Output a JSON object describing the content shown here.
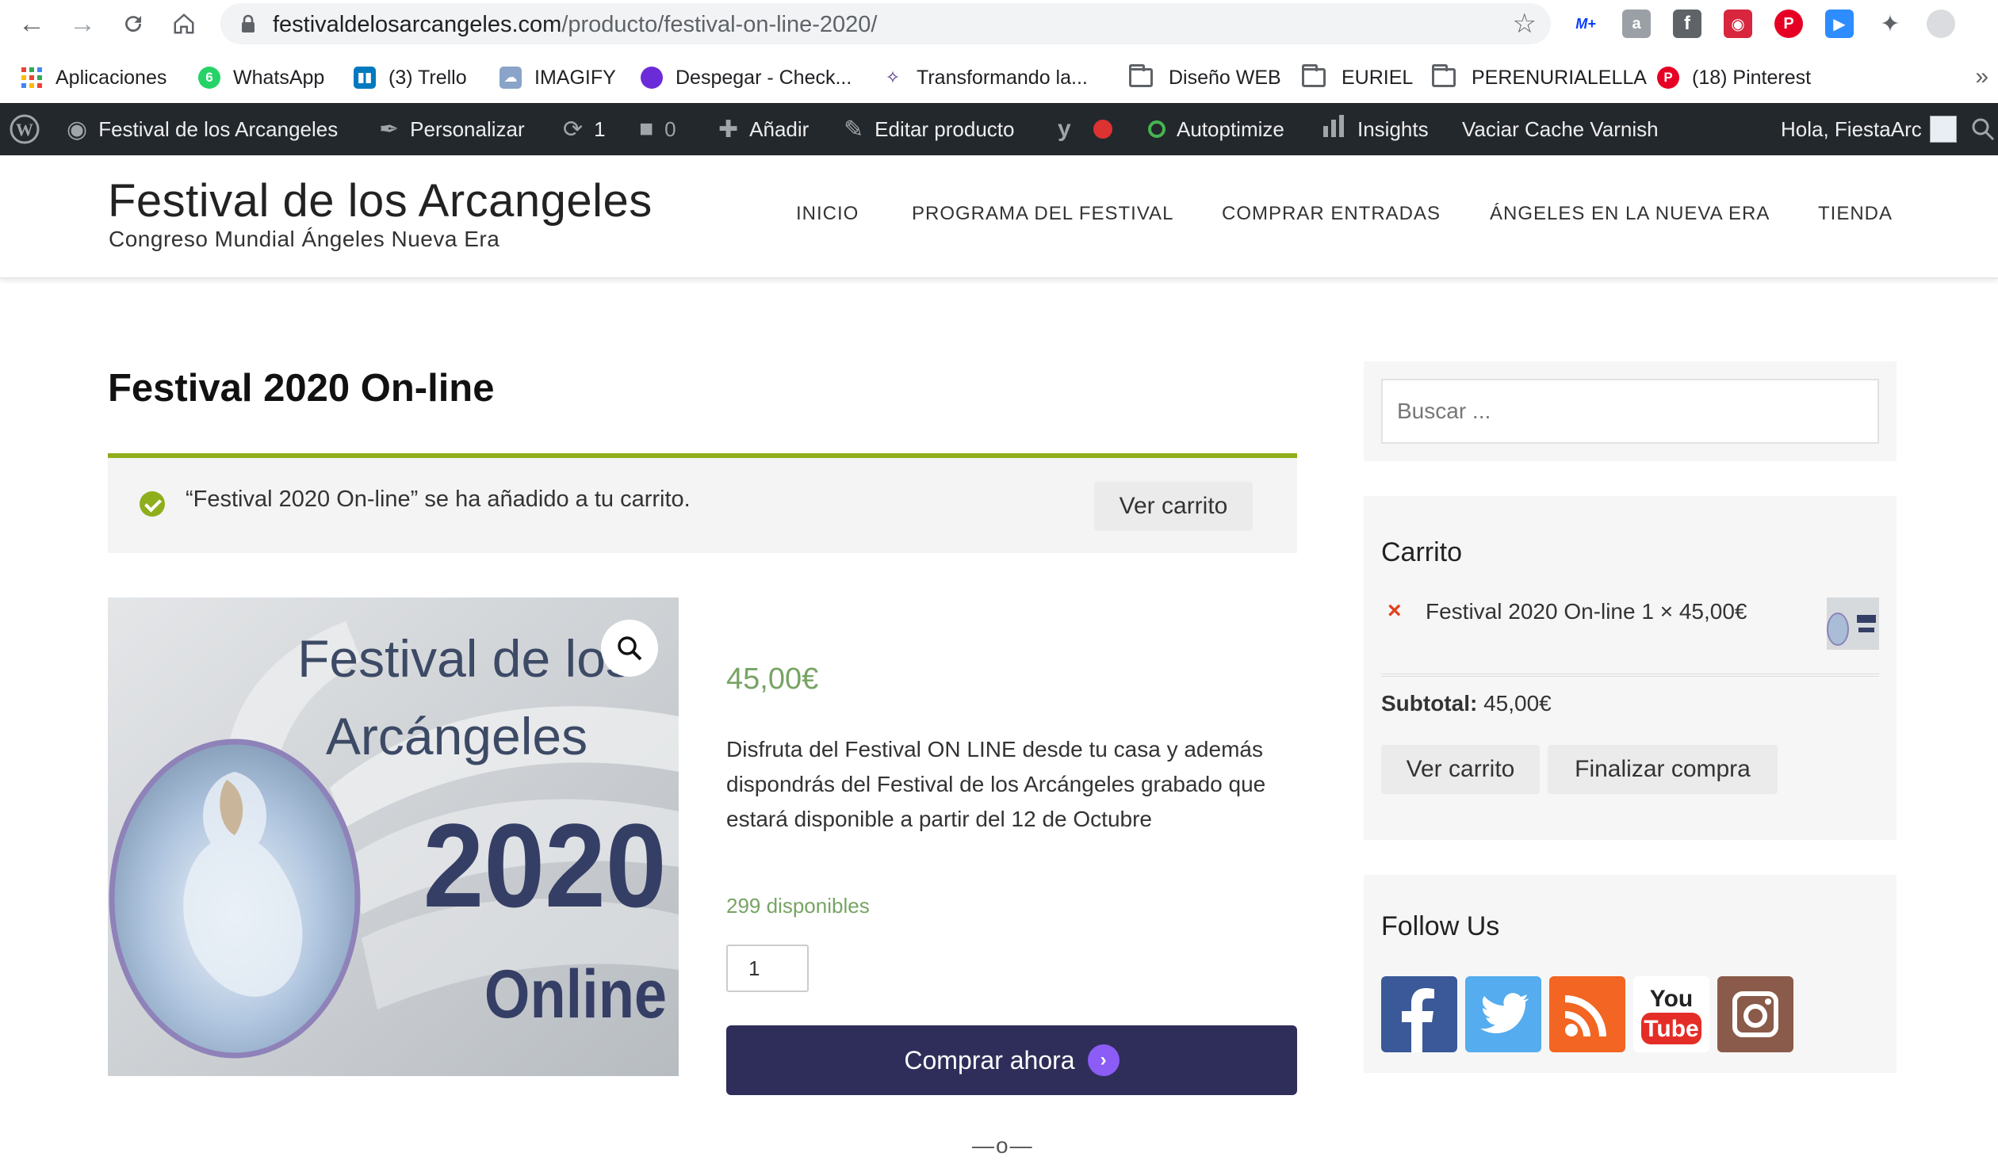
{
  "browser": {
    "url_domain": "festivaldelosarcangeles.com",
    "url_path": "/producto/festival-on-line-2020/"
  },
  "bookmarks": {
    "items": [
      {
        "label": "Aplicaciones"
      },
      {
        "label": "WhatsApp",
        "badge": "6"
      },
      {
        "label": "(3) Trello"
      },
      {
        "label": "IMAGIFY"
      },
      {
        "label": "Despegar - Check..."
      },
      {
        "label": "Transformando la..."
      },
      {
        "label": "Diseño WEB"
      },
      {
        "label": "EURIEL"
      },
      {
        "label": "PERENURIALELLA"
      },
      {
        "label": "(18) Pinterest"
      }
    ],
    "more": "»"
  },
  "adminbar": {
    "site": "Festival de los Arcangeles",
    "customize": "Personalizar",
    "updates_count": "1",
    "comments_count": "0",
    "add_new": "Añadir",
    "edit_product": "Editar producto",
    "autoptimize": "Autoptimize",
    "insights": "Insights",
    "varnish": "Vaciar Cache Varnish",
    "greeting": "Hola, FiestaArc"
  },
  "header": {
    "site_title": "Festival de los Arcangeles",
    "site_description": "Congreso Mundial Ángeles Nueva Era",
    "menu": [
      "INICIO",
      "PROGRAMA DEL FESTIVAL",
      "COMPRAR ENTRADAS",
      "ÁNGELES EN LA NUEVA ERA",
      "TIENDA"
    ]
  },
  "product": {
    "title": "Festival 2020 On-line",
    "notice_text": "“Festival 2020 On-line” se ha añadido a tu carrito.",
    "view_cart_label": "Ver carrito",
    "price": "45,00€",
    "description": "Disfruta del Festival ON LINE desde tu casa y además dispondrás del Festival de los Arcángeles grabado que estará disponible a partir del 12 de Octubre",
    "stock": "299 disponibles",
    "quantity": "1",
    "buy_label": "Comprar ahora",
    "separator": "—o—",
    "image_text": {
      "line1": "Festival de los",
      "line2": "Arcángeles",
      "year": "2020",
      "online": "Online"
    }
  },
  "sidebar": {
    "search_placeholder": "Buscar ...",
    "cart_title": "Carrito",
    "cart_item": "Festival 2020 On-line 1 × 45,00€",
    "remove_symbol": "×",
    "subtotal_label": "Subtotal:",
    "subtotal_value": "45,00€",
    "view_cart_label": "Ver carrito",
    "checkout_label": "Finalizar compra",
    "follow_title": "Follow Us"
  },
  "colors": {
    "accent_green": "#8fae1b",
    "price_green": "#77a464",
    "buy_button": "#2f2e5a",
    "adminbar": "#23282d"
  }
}
